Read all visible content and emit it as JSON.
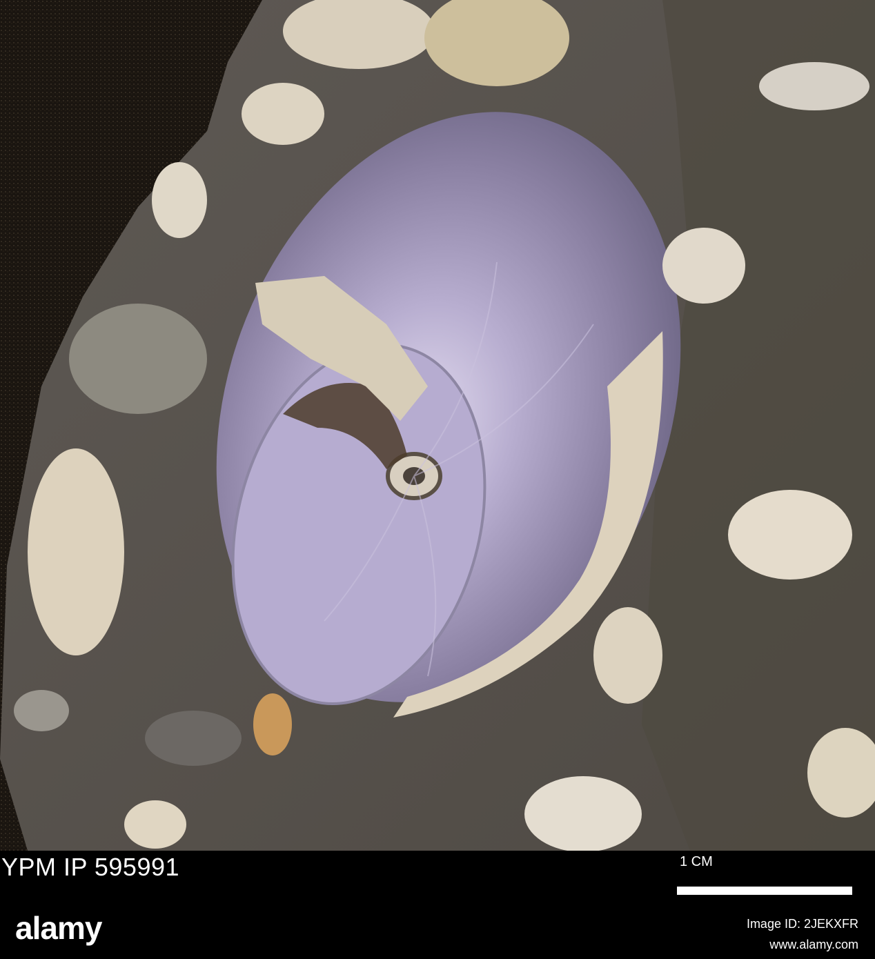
{
  "photo": {
    "subject": "fossil-ammonite-in-matrix",
    "colors": {
      "background": "#1a1510",
      "matrix": "#5b5650",
      "shell_nacre": "#8f84a8",
      "shell_highlight": "#cfc6e6",
      "shell_fragment": "#ddd2bd"
    }
  },
  "caption": {
    "specimen_id": "YPM IP 595991",
    "scale_label": "1 CM"
  },
  "watermark": {
    "logo": "alamy",
    "image_id": "Image ID: 2JEKXFR",
    "url": "www.alamy.com"
  }
}
